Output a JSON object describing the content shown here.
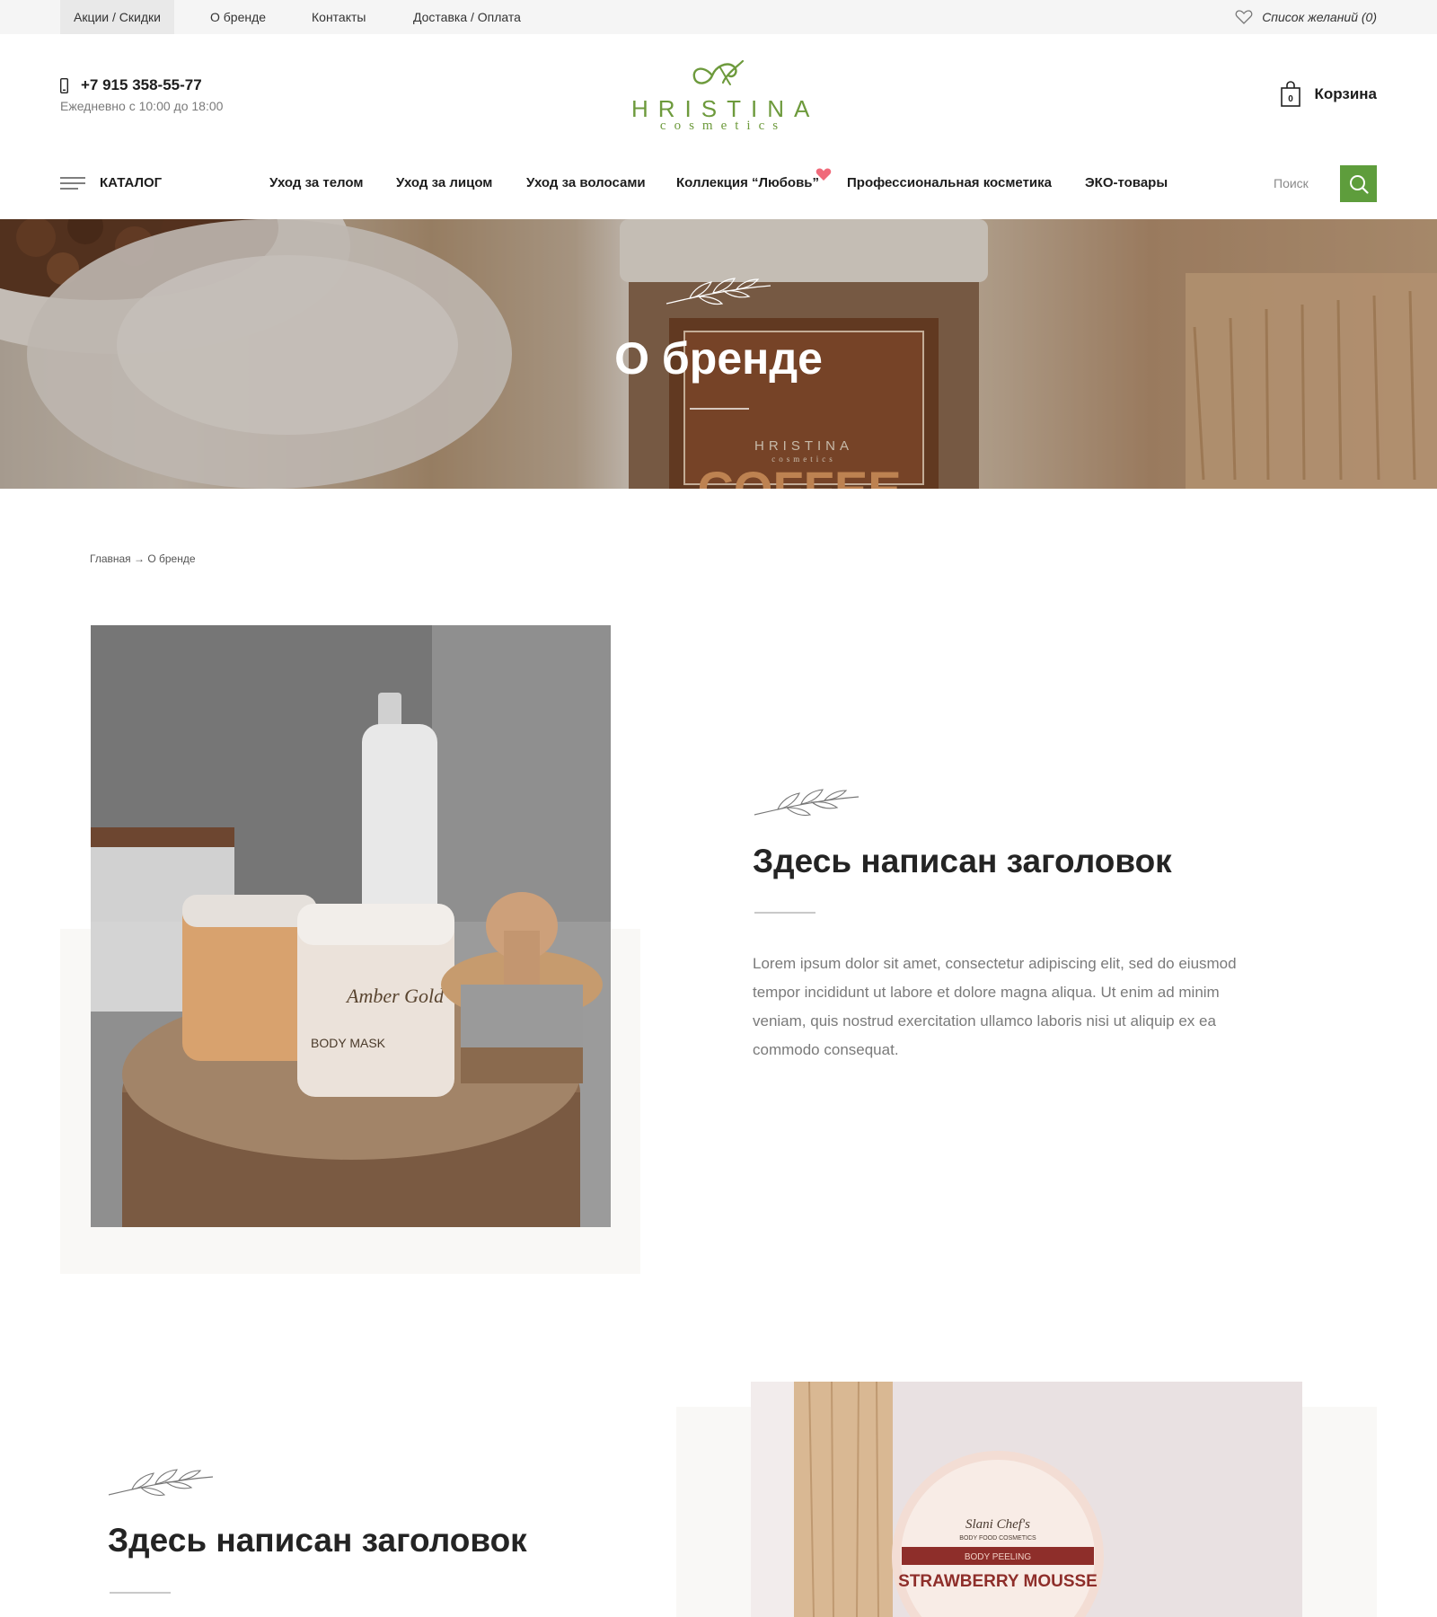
{
  "topbar": {
    "links": [
      "Акции / Скидки",
      "О бренде",
      "Контакты",
      "Доставка / Оплата"
    ],
    "wishlist": "Список желаний (0)"
  },
  "header": {
    "phone": "+7 915 358-55-77",
    "hours": "Ежедневно с 10:00 до 18:00",
    "logo_main": "HRISTINA",
    "logo_sub": "cosmetics",
    "cart_label": "Корзина",
    "cart_count": "0"
  },
  "nav": {
    "catalog": "КАТАЛОГ",
    "items": [
      "Уход за телом",
      "Уход за лицом",
      "Уход за волосами",
      "Коллекция “Любовь”",
      "Профессиональная косметика",
      "ЭКО-товары"
    ],
    "search_placeholder": "Поиск"
  },
  "hero": {
    "title": "О бренде",
    "jar_brand": "HRISTINA",
    "jar_sub": "cosmetics",
    "jar_label": "COFFEE"
  },
  "breadcrumb": "Главная → О бренде",
  "section1": {
    "heading": "Здесь написан заголовок",
    "paragraph": "Lorem ipsum dolor sit amet, consectetur adipiscing elit, sed do eiusmod tempor incididunt ut labore et dolore magna aliqua. Ut enim ad minim veniam, quis nostrud exercitation ullamco laboris nisi ut aliquip ex ea commodo consequat.",
    "jar1_label": "Amber Gold",
    "jar2_label": "BODY MASK"
  },
  "section2": {
    "heading": "Здесь написан заголовок",
    "jar_brand": "Slani Chef's",
    "jar_brand_sub": "BODY FOOD COSMETICS",
    "jar_type": "BODY PEELING",
    "jar_name": "STRAWBERRY MOUSSE"
  },
  "colors": {
    "accent_green": "#5e9d3c",
    "logo_green": "#6d9a3c",
    "heart_pink": "#f06a7a"
  }
}
